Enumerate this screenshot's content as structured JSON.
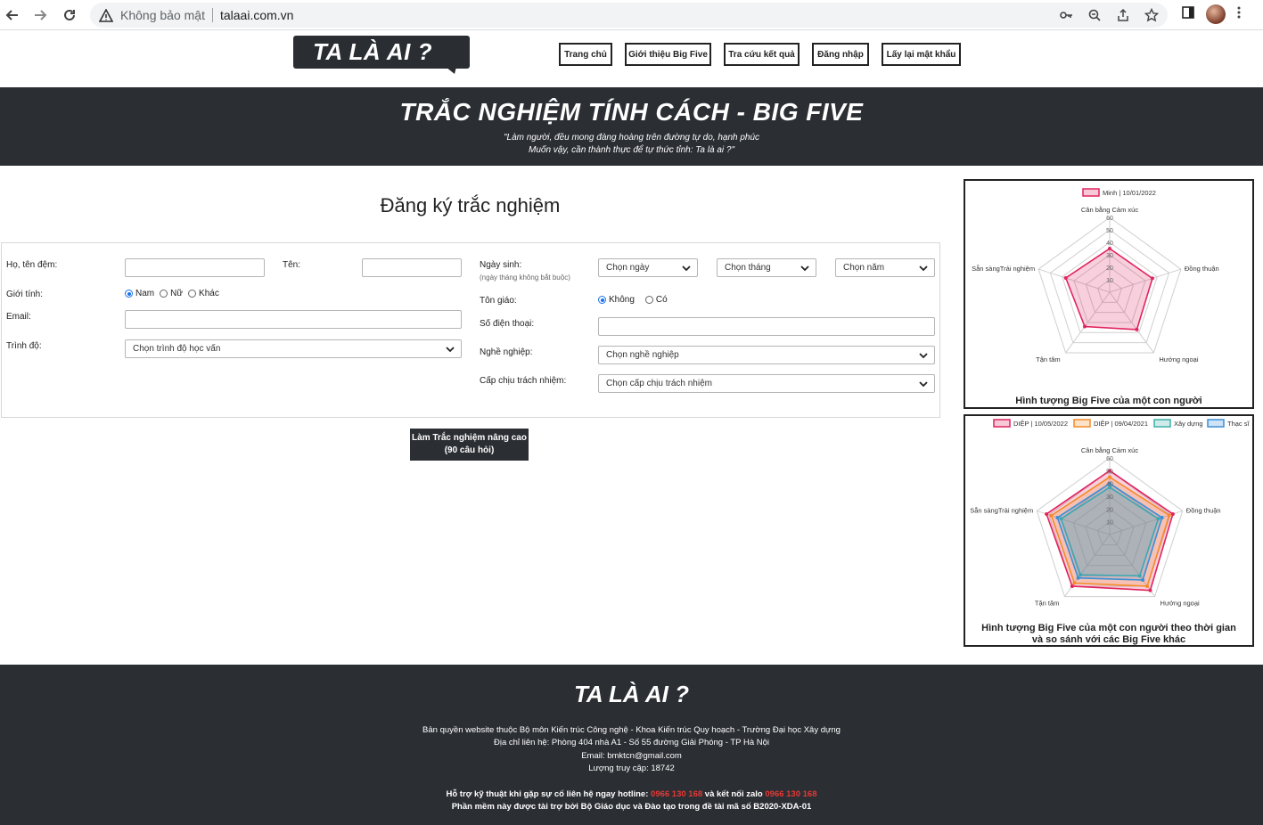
{
  "browser": {
    "security_text": "Không bảo mật",
    "url": "talaai.com.vn"
  },
  "site": {
    "logo": "TA LÀ AI ?",
    "menu": [
      "Trang chủ",
      "Giới thiệu Big Five",
      "Tra cứu kết quả",
      "Đăng nhập",
      "Lấy lại mật khẩu"
    ]
  },
  "banner": {
    "title": "TRẮC NGHIỆM TÍNH CÁCH - BIG FIVE",
    "quote_line1": "\"Làm người, đều mong đàng hoàng trên đường tự do, hạnh phúc",
    "quote_line2": "Muốn vậy, cần thành thực để tự thức tỉnh: Ta là ai ?\""
  },
  "form": {
    "title": "Đăng ký trắc nghiệm",
    "labels": {
      "fullname": "Họ, tên đệm:",
      "name": "Tên:",
      "gender": "Giới tính:",
      "email": "Email:",
      "education": "Trình độ:",
      "birthday": "Ngày sinh:",
      "birthday_hint": "(ngày tháng không bắt buộc)",
      "religion": "Tôn giáo:",
      "phone": "Số điện thoại:",
      "job": "Nghề nghiệp:",
      "responsibility": "Cấp chịu trách nhiệm:"
    },
    "gender_options": [
      "Nam",
      "Nữ",
      "Khác"
    ],
    "religion_options": [
      "Không",
      "Có"
    ],
    "selects": {
      "day": "Chọn ngày",
      "month": "Chọn tháng",
      "year": "Chọn năm",
      "education": "Chọn trình độ học vấn",
      "job": "Chọn nghề nghiệp",
      "responsibility": "Chọn cấp chịu trách nhiệm"
    },
    "submit_line1": "Làm Trắc nghiệm nâng cao",
    "submit_line2": "(90 câu hỏi)"
  },
  "chart_data": [
    {
      "type": "radar",
      "axes": [
        "Cân bằng Cảm xúc",
        "Đồng thuận",
        "Hướng ngoại",
        "Tận tâm",
        "Sẵn sàngTrải nghiệm"
      ],
      "rlim": [
        0,
        60
      ],
      "ticks": [
        10,
        20,
        30,
        40,
        50,
        60
      ],
      "legend_position": "top",
      "series": [
        {
          "name": "Minh | 10/01/2022",
          "color": "#e0245e",
          "values": [
            35,
            36,
            37,
            34,
            37
          ]
        }
      ],
      "caption": "Hình tượng Big Five của một con người"
    },
    {
      "type": "radar",
      "axes": [
        "Cân bằng Cảm xúc",
        "Đồng thuận",
        "Hướng ngoại",
        "Tận tâm",
        "Sẵn sàngTrải nghiệm"
      ],
      "rlim": [
        0,
        60
      ],
      "ticks": [
        10,
        20,
        30,
        40,
        50,
        60
      ],
      "legend_position": "top",
      "series": [
        {
          "name": "DIỆP | 10/05/2022",
          "color": "#e0245e",
          "values": [
            50,
            52,
            54,
            50,
            52
          ]
        },
        {
          "name": "DIỆP | 09/04/2021",
          "color": "#f28c28",
          "values": [
            45,
            49,
            50,
            47,
            48
          ]
        },
        {
          "name": "Xây dựng",
          "color": "#3ab0a8",
          "values": [
            37,
            40,
            40,
            39,
            40
          ]
        },
        {
          "name": "Thạc sĩ",
          "color": "#3a8fd6",
          "values": [
            40,
            43,
            44,
            42,
            43
          ]
        }
      ],
      "caption_line1": "Hình tượng Big Five của một con người theo thời gian",
      "caption_line2": "và so sánh với các Big Five khác"
    }
  ],
  "footer": {
    "logo": "TA LÀ AI ?",
    "line1": "Bản quyền website thuộc Bộ môn Kiến trúc Công nghệ - Khoa Kiến trúc Quy hoạch - Trường Đại học Xây dựng",
    "line2": "Địa chỉ liên hệ: Phòng 404 nhà A1 - Số 55 đường Giải Phóng - TP Hà Nội",
    "line3": "Email: bmktcn@gmail.com",
    "line4": "Lượng truy cập: 18742",
    "support_prefix": "Hỗ trợ kỹ thuật khi gặp sự cố liên hệ ngay hotline: ",
    "hotline": "0966 130 168",
    "support_mid": " và kết nối zalo ",
    "zalo": "0966 130 168",
    "line6": "Phần mềm này được tài trợ bởi Bộ Giáo dục và Đào tạo trong đề tài mã số B2020-XDA-01"
  }
}
